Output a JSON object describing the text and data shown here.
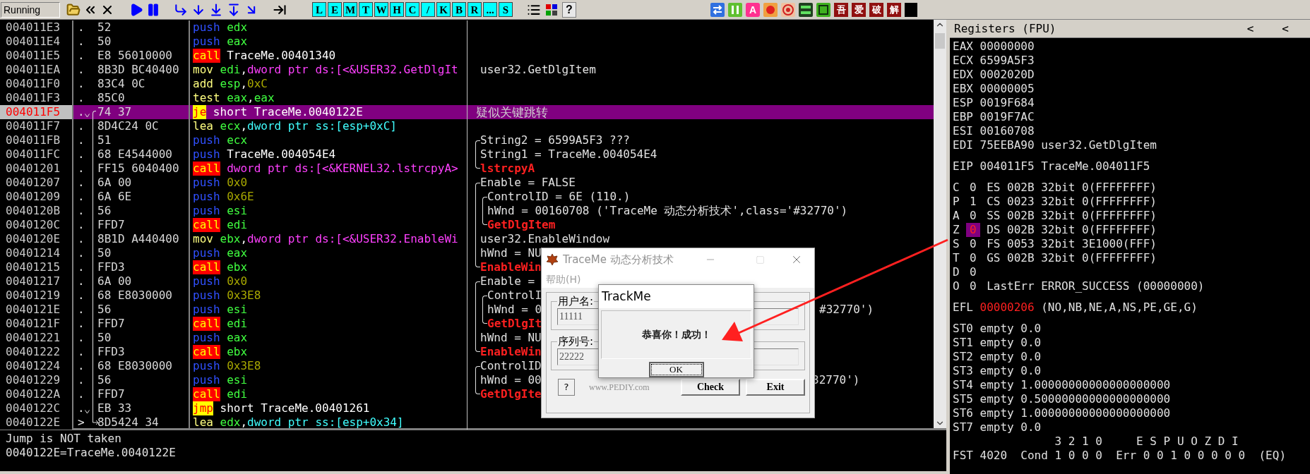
{
  "toolbar": {
    "status": "Running",
    "letter_buttons": [
      "L",
      "E",
      "M",
      "T",
      "W",
      "H",
      "C",
      "/",
      "K",
      "B",
      "R",
      "...",
      "S"
    ],
    "help": "?",
    "plugin_glyph": "A",
    "cn_buttons": [
      "吾",
      "爱",
      "破",
      "解"
    ]
  },
  "disasm": {
    "rows": [
      {
        "address": "004011E3",
        "marker": ".",
        "hex": "52",
        "mnemonic": {
          "text": "push",
          "kind": "push"
        },
        "operands": [
          {
            "text": "edx",
            "kind": "reg"
          }
        ],
        "selected": false,
        "jump_down": false
      },
      {
        "address": "004011E4",
        "marker": ".",
        "hex": "50",
        "mnemonic": {
          "text": "push",
          "kind": "push"
        },
        "operands": [
          {
            "text": "eax",
            "kind": "reg"
          }
        ],
        "selected": false,
        "jump_down": false
      },
      {
        "address": "004011E5",
        "marker": ".",
        "hex": "E8 56010000",
        "mnemonic": {
          "text": "call",
          "kind": "call"
        },
        "operands": [
          {
            "text": "TraceMe.00401340",
            "kind": "label"
          }
        ],
        "selected": false,
        "jump_down": false
      },
      {
        "address": "004011EA",
        "marker": ".",
        "hex": "8B3D BC40400",
        "mnemonic": {
          "text": "mov",
          "kind": "plain"
        },
        "operands": [
          {
            "text": "edi",
            "kind": "reg"
          },
          {
            "text": ",",
            "kind": "punct"
          },
          {
            "text": "dword ptr ds:[<&USER32.GetDlgIt",
            "kind": "mem"
          }
        ],
        "selected": false,
        "jump_down": false,
        "comment": {
          "text": "user32.GetDlgItem",
          "kind": "plain"
        }
      },
      {
        "address": "004011F0",
        "marker": ".",
        "hex": "83C4 0C",
        "mnemonic": {
          "text": "add",
          "kind": "plain"
        },
        "operands": [
          {
            "text": "esp",
            "kind": "reg"
          },
          {
            "text": ",",
            "kind": "punct"
          },
          {
            "text": "0xC",
            "kind": "imm"
          }
        ],
        "selected": false,
        "jump_down": false
      },
      {
        "address": "004011F3",
        "marker": ".",
        "hex": "85C0",
        "mnemonic": {
          "text": "test",
          "kind": "plain"
        },
        "operands": [
          {
            "text": "eax",
            "kind": "reg"
          },
          {
            "text": ",",
            "kind": "punct"
          },
          {
            "text": "eax",
            "kind": "reg"
          }
        ],
        "selected": false,
        "jump_down": false
      },
      {
        "address": "004011F5",
        "marker": ".",
        "hex": "74 37",
        "mnemonic": {
          "text": "je",
          "kind": "jump"
        },
        "operands": [
          {
            "text": "short TraceMe.0040122E",
            "kind": "label"
          }
        ],
        "selected": true,
        "jump_down": true,
        "jump": {
          "kind": "start"
        },
        "comment": {
          "text": "疑似关键跳转",
          "kind": "note"
        }
      },
      {
        "address": "004011F7",
        "marker": ".",
        "hex": "8D4C24 0C",
        "mnemonic": {
          "text": "lea",
          "kind": "plain"
        },
        "operands": [
          {
            "text": "ecx",
            "kind": "reg"
          },
          {
            "text": ",",
            "kind": "punct"
          },
          {
            "text": "dword ptr ss:[esp+0xC]",
            "kind": "stack"
          }
        ],
        "selected": false,
        "jump_down": false,
        "jump": {
          "kind": "through"
        }
      },
      {
        "address": "004011FB",
        "marker": ".",
        "hex": "51",
        "mnemonic": {
          "text": "push",
          "kind": "push"
        },
        "operands": [
          {
            "text": "ecx",
            "kind": "reg"
          }
        ],
        "selected": false,
        "jump_down": false,
        "jump": {
          "kind": "through"
        },
        "comment": {
          "text": "String2 = 6599A5F3 ???",
          "kind": "plain",
          "outer": {
            "kind": "top"
          }
        }
      },
      {
        "address": "004011FC",
        "marker": ".",
        "hex": "68 E4544000",
        "mnemonic": {
          "text": "push",
          "kind": "push"
        },
        "operands": [
          {
            "text": "TraceMe.004054E4",
            "kind": "label"
          }
        ],
        "selected": false,
        "jump_down": false,
        "jump": {
          "kind": "through"
        },
        "comment": {
          "text": "String1 = TraceMe.004054E4",
          "kind": "plain",
          "outer": {
            "kind": "mid"
          }
        }
      },
      {
        "address": "00401201",
        "marker": ".",
        "hex": "FF15 6040400",
        "mnemonic": {
          "text": "call",
          "kind": "call"
        },
        "operands": [
          {
            "text": "dword ptr ds:[<&KERNEL32.lstrcpyA>",
            "kind": "mem"
          }
        ],
        "selected": false,
        "jump_down": false,
        "jump": {
          "kind": "through"
        },
        "comment": {
          "text": "lstrcpyA",
          "kind": "api",
          "outer": {
            "kind": "bottom"
          }
        }
      },
      {
        "address": "00401207",
        "marker": ".",
        "hex": "6A 00",
        "mnemonic": {
          "text": "push",
          "kind": "push"
        },
        "operands": [
          {
            "text": "0x0",
            "kind": "imm"
          }
        ],
        "selected": false,
        "jump_down": false,
        "jump": {
          "kind": "through"
        },
        "comment": {
          "text": "Enable = FALSE",
          "kind": "plain",
          "outer": {
            "kind": "top"
          }
        }
      },
      {
        "address": "00401209",
        "marker": ".",
        "hex": "6A 6E",
        "mnemonic": {
          "text": "push",
          "kind": "push"
        },
        "operands": [
          {
            "text": "0x6E",
            "kind": "imm"
          }
        ],
        "selected": false,
        "jump_down": false,
        "jump": {
          "kind": "through"
        },
        "comment": {
          "text": "ControlID = 6E (110.)",
          "kind": "plain",
          "outer": {
            "kind": "mid"
          },
          "inner": {
            "kind": "top"
          }
        }
      },
      {
        "address": "0040120B",
        "marker": ".",
        "hex": "56",
        "mnemonic": {
          "text": "push",
          "kind": "push"
        },
        "operands": [
          {
            "text": "esi",
            "kind": "reg"
          }
        ],
        "selected": false,
        "jump_down": false,
        "jump": {
          "kind": "through"
        },
        "comment": {
          "text": "hWnd = 00160708 ('TraceMe 动态分析技术',class='#32770')",
          "kind": "plain",
          "outer": {
            "kind": "mid"
          },
          "inner": {
            "kind": "mid"
          }
        }
      },
      {
        "address": "0040120C",
        "marker": ".",
        "hex": "FFD7",
        "mnemonic": {
          "text": "call",
          "kind": "call"
        },
        "operands": [
          {
            "text": "edi",
            "kind": "reg"
          }
        ],
        "selected": false,
        "jump_down": false,
        "jump": {
          "kind": "through"
        },
        "comment": {
          "text": "GetDlgItem",
          "kind": "api",
          "outer": {
            "kind": "mid"
          },
          "inner": {
            "kind": "bottom"
          }
        }
      },
      {
        "address": "0040120E",
        "marker": ".",
        "hex": "8B1D A440400",
        "mnemonic": {
          "text": "mov",
          "kind": "plain"
        },
        "operands": [
          {
            "text": "ebx",
            "kind": "reg"
          },
          {
            "text": ",",
            "kind": "punct"
          },
          {
            "text": "dword ptr ds:[<&USER32.EnableWi",
            "kind": "mem"
          }
        ],
        "selected": false,
        "jump_down": false,
        "jump": {
          "kind": "through"
        },
        "comment": {
          "text": "user32.EnableWindow",
          "kind": "plain",
          "outer": {
            "kind": "mid"
          }
        }
      },
      {
        "address": "00401214",
        "marker": ".",
        "hex": "50",
        "mnemonic": {
          "text": "push",
          "kind": "push"
        },
        "operands": [
          {
            "text": "eax",
            "kind": "reg"
          }
        ],
        "selected": false,
        "jump_down": false,
        "jump": {
          "kind": "through"
        },
        "comment": {
          "text": "hWnd = NU",
          "kind": "plain",
          "outer": {
            "kind": "mid"
          }
        }
      },
      {
        "address": "00401215",
        "marker": ".",
        "hex": "FFD3",
        "mnemonic": {
          "text": "call",
          "kind": "call"
        },
        "operands": [
          {
            "text": "ebx",
            "kind": "reg"
          }
        ],
        "selected": false,
        "jump_down": false,
        "jump": {
          "kind": "through"
        },
        "comment": {
          "text": "EnableWin",
          "kind": "api",
          "outer": {
            "kind": "bottom"
          }
        }
      },
      {
        "address": "00401217",
        "marker": ".",
        "hex": "6A 00",
        "mnemonic": {
          "text": "push",
          "kind": "push"
        },
        "operands": [
          {
            "text": "0x0",
            "kind": "imm"
          }
        ],
        "selected": false,
        "jump_down": false,
        "jump": {
          "kind": "through"
        },
        "comment": {
          "text": "Enable =",
          "kind": "plain",
          "outer": {
            "kind": "top"
          }
        }
      },
      {
        "address": "00401219",
        "marker": ".",
        "hex": "68 E8030000",
        "mnemonic": {
          "text": "push",
          "kind": "push"
        },
        "operands": [
          {
            "text": "0x3E8",
            "kind": "imm"
          }
        ],
        "selected": false,
        "jump_down": false,
        "jump": {
          "kind": "through"
        },
        "comment": {
          "text": "ControlI",
          "kind": "plain",
          "outer": {
            "kind": "mid"
          },
          "inner": {
            "kind": "top"
          }
        }
      },
      {
        "address": "0040121E",
        "marker": ".",
        "hex": "56",
        "mnemonic": {
          "text": "push",
          "kind": "push"
        },
        "operands": [
          {
            "text": "esi",
            "kind": "reg"
          }
        ],
        "selected": false,
        "jump_down": false,
        "jump": {
          "kind": "through"
        },
        "comment": {
          "text": "hWnd = 0",
          "kind": "plain",
          "outer": {
            "kind": "mid"
          },
          "inner": {
            "kind": "mid"
          },
          "tail": "#32770')"
        }
      },
      {
        "address": "0040121F",
        "marker": ".",
        "hex": "FFD7",
        "mnemonic": {
          "text": "call",
          "kind": "call"
        },
        "operands": [
          {
            "text": "edi",
            "kind": "reg"
          }
        ],
        "selected": false,
        "jump_down": false,
        "jump": {
          "kind": "through"
        },
        "comment": {
          "text": "GetDlgIt",
          "kind": "api",
          "outer": {
            "kind": "mid"
          },
          "inner": {
            "kind": "bottom"
          }
        }
      },
      {
        "address": "00401221",
        "marker": ".",
        "hex": "50",
        "mnemonic": {
          "text": "push",
          "kind": "push"
        },
        "operands": [
          {
            "text": "eax",
            "kind": "reg"
          }
        ],
        "selected": false,
        "jump_down": false,
        "jump": {
          "kind": "through"
        },
        "comment": {
          "text": "hWnd = NU",
          "kind": "plain",
          "outer": {
            "kind": "mid"
          }
        }
      },
      {
        "address": "00401222",
        "marker": ".",
        "hex": "FFD3",
        "mnemonic": {
          "text": "call",
          "kind": "call"
        },
        "operands": [
          {
            "text": "ebx",
            "kind": "reg"
          }
        ],
        "selected": false,
        "jump_down": false,
        "jump": {
          "kind": "through"
        },
        "comment": {
          "text": "EnableWin",
          "kind": "api",
          "outer": {
            "kind": "bottom"
          }
        }
      },
      {
        "address": "00401224",
        "marker": ".",
        "hex": "68 E8030000",
        "mnemonic": {
          "text": "push",
          "kind": "push"
        },
        "operands": [
          {
            "text": "0x3E8",
            "kind": "imm"
          }
        ],
        "selected": false,
        "jump_down": false,
        "jump": {
          "kind": "through"
        },
        "comment": {
          "text": "ControlID",
          "kind": "plain",
          "outer": {
            "kind": "top"
          }
        }
      },
      {
        "address": "00401229",
        "marker": ".",
        "hex": "56",
        "mnemonic": {
          "text": "push",
          "kind": "push"
        },
        "operands": [
          {
            "text": "esi",
            "kind": "reg"
          }
        ],
        "selected": false,
        "jump_down": false,
        "jump": {
          "kind": "through"
        },
        "comment": {
          "text": "hWnd = 00",
          "kind": "plain",
          "outer": {
            "kind": "mid"
          },
          "tail": "32770')"
        }
      },
      {
        "address": "0040122A",
        "marker": ".",
        "hex": "FFD7",
        "mnemonic": {
          "text": "call",
          "kind": "call"
        },
        "operands": [
          {
            "text": "edi",
            "kind": "reg"
          }
        ],
        "selected": false,
        "jump_down": false,
        "jump": {
          "kind": "through"
        },
        "comment": {
          "text": "GetDlgIte",
          "kind": "api",
          "outer": {
            "kind": "bottom"
          }
        }
      },
      {
        "address": "0040122C",
        "marker": ".",
        "hex": "EB 33",
        "mnemonic": {
          "text": "jmp",
          "kind": "jump"
        },
        "operands": [
          {
            "text": "short TraceMe.00401261",
            "kind": "label"
          }
        ],
        "selected": false,
        "jump_down": true,
        "jump": {
          "kind": "through"
        }
      },
      {
        "address": "0040122E",
        "marker": ">",
        "hex": "8D5424 34",
        "mnemonic": {
          "text": "lea",
          "kind": "plain"
        },
        "operands": [
          {
            "text": "edx",
            "kind": "reg"
          },
          {
            "text": ",",
            "kind": "punct"
          },
          {
            "text": "dword ptr ss:[esp+0x34]",
            "kind": "stack"
          }
        ],
        "selected": false,
        "jump_down": false,
        "jump": {
          "kind": "end"
        }
      }
    ]
  },
  "info": [
    "Jump is NOT taken",
    "0040122E=TraceMe.0040122E"
  ],
  "registers": {
    "title": "Registers (FPU)",
    "nav": [
      "<",
      "<"
    ],
    "general": [
      {
        "name": "EAX",
        "value": "00000000"
      },
      {
        "name": "ECX",
        "value": "6599A5F3"
      },
      {
        "name": "EDX",
        "value": "0002020D"
      },
      {
        "name": "EBX",
        "value": "00000005"
      },
      {
        "name": "ESP",
        "value": "0019F684"
      },
      {
        "name": "EBP",
        "value": "0019F7AC"
      },
      {
        "name": "ESI",
        "value": "00160708"
      },
      {
        "name": "EDI",
        "value": "75EEBA90",
        "comment": "user32.GetDlgItem"
      }
    ],
    "eip": {
      "name": "EIP",
      "value": "004011F5",
      "comment": "TraceMe.004011F5"
    },
    "flags": [
      {
        "name": "C",
        "value": "0",
        "selected": false,
        "changed": false,
        "detail": "ES 002B 32bit 0(FFFFFFFF)"
      },
      {
        "name": "P",
        "value": "1",
        "selected": false,
        "changed": false,
        "detail": "CS 0023 32bit 0(FFFFFFFF)"
      },
      {
        "name": "A",
        "value": "0",
        "selected": false,
        "changed": false,
        "detail": "SS 002B 32bit 0(FFFFFFFF)"
      },
      {
        "name": "Z",
        "value": "0",
        "selected": true,
        "changed": true,
        "detail": "DS 002B 32bit 0(FFFFFFFF)"
      },
      {
        "name": "S",
        "value": "0",
        "selected": false,
        "changed": false,
        "detail": "FS 0053 32bit 3E1000(FFF)"
      },
      {
        "name": "T",
        "value": "0",
        "selected": false,
        "changed": false,
        "detail": "GS 002B 32bit 0(FFFFFFFF)"
      },
      {
        "name": "D",
        "value": "0",
        "selected": false,
        "changed": false
      },
      {
        "name": "O",
        "value": "0",
        "selected": false,
        "changed": false,
        "detail": "LastErr ERROR_SUCCESS (00000000)"
      }
    ],
    "efl": {
      "name": "EFL",
      "value": "00000206",
      "changed": true,
      "decoded": "(NO,NB,NE,A,NS,PE,GE,G)"
    },
    "fpu": [
      {
        "name": "ST0",
        "state": "empty",
        "value": "0.0"
      },
      {
        "name": "ST1",
        "state": "empty",
        "value": "0.0"
      },
      {
        "name": "ST2",
        "state": "empty",
        "value": "0.0"
      },
      {
        "name": "ST3",
        "state": "empty",
        "value": "0.0"
      },
      {
        "name": "ST4",
        "state": "empty",
        "value": "1.00000000000000000000"
      },
      {
        "name": "ST5",
        "state": "empty",
        "value": "0.50000000000000000000"
      },
      {
        "name": "ST6",
        "state": "empty",
        "value": "1.00000000000000000000"
      },
      {
        "name": "ST7",
        "state": "empty",
        "value": "0.0"
      }
    ],
    "fpu_header": "3 2 1 0     E S P U O Z D I",
    "fst": "FST 4020  Cond 1 0 0 0  Err 0 0 1 0 0 0 0 0  (EQ)"
  },
  "app_dialog": {
    "title": "TraceMe 动态分析技术",
    "menu": [
      "帮助(H)"
    ],
    "groups": [
      {
        "label": "用户名:",
        "value": "11111"
      },
      {
        "label": "序列号:",
        "value": "22222"
      }
    ],
    "help_button": "?",
    "website": "www.PEDIY.com",
    "buttons": [
      "Check",
      "Exit"
    ]
  },
  "message_box": {
    "title": "TrackMe",
    "text": "恭喜你！成功！",
    "button": "OK"
  }
}
